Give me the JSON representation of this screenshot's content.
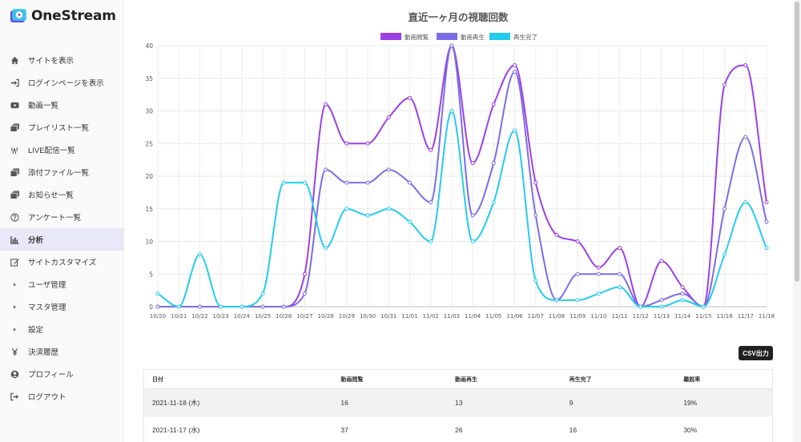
{
  "brand": {
    "name": "OneStream"
  },
  "sidebar": {
    "items": [
      {
        "label": "サイトを表示",
        "icon": "home-icon"
      },
      {
        "label": "ログインページを表示",
        "icon": "sign-in-icon"
      },
      {
        "label": "動画一覧",
        "icon": "video-icon"
      },
      {
        "label": "プレイリスト一覧",
        "icon": "playlist-icon"
      },
      {
        "label": "LIVE配信一覧",
        "icon": "broadcast-icon"
      },
      {
        "label": "添付ファイル一覧",
        "icon": "attachment-icon"
      },
      {
        "label": "お知らせ一覧",
        "icon": "news-icon"
      },
      {
        "label": "アンケート一覧",
        "icon": "question-icon"
      },
      {
        "label": "分析",
        "icon": "bar-chart-icon",
        "active": true
      },
      {
        "label": "サイトカスタマイズ",
        "icon": "edit-icon"
      },
      {
        "label": "ユーザ管理",
        "icon": "chevron-right-icon"
      },
      {
        "label": "マスタ管理",
        "icon": "chevron-right-icon"
      },
      {
        "label": "設定",
        "icon": "chevron-right-icon"
      },
      {
        "label": "決済履歴",
        "icon": "yen-icon"
      },
      {
        "label": "プロフィール",
        "icon": "user-icon"
      },
      {
        "label": "ログアウト",
        "icon": "sign-out-icon"
      }
    ]
  },
  "chart_data": {
    "type": "line",
    "title": "直近一ヶ月の視聴回数",
    "categories": [
      "10/20",
      "10/21",
      "10/22",
      "10/23",
      "10/24",
      "10/25",
      "10/26",
      "10/27",
      "10/28",
      "10/29",
      "10/30",
      "10/31",
      "11/01",
      "11/02",
      "11/03",
      "11/04",
      "11/05",
      "11/06",
      "11/07",
      "11/08",
      "11/09",
      "11/10",
      "11/11",
      "11/12",
      "11/13",
      "11/14",
      "11/15",
      "11/16",
      "11/17",
      "11/18"
    ],
    "series": [
      {
        "name": "動画閲覧",
        "color": "#9b3fe6",
        "values": [
          0,
          0,
          0,
          0,
          0,
          0,
          0,
          5,
          31,
          25,
          25,
          29,
          32,
          24,
          40,
          22,
          31,
          37,
          19,
          11,
          10,
          6,
          9,
          0,
          7,
          3,
          0,
          34,
          37,
          16
        ]
      },
      {
        "name": "動画再生",
        "color": "#7b6ce8",
        "values": [
          0,
          0,
          0,
          0,
          0,
          0,
          0,
          2,
          21,
          19,
          19,
          21,
          19,
          16,
          40,
          14,
          22,
          36,
          14,
          1,
          5,
          5,
          5,
          0,
          1,
          2,
          0,
          15,
          26,
          13
        ]
      },
      {
        "name": "再生完了",
        "color": "#22ccec",
        "values": [
          2,
          0,
          8,
          0,
          0,
          2,
          19,
          19,
          9,
          15,
          14,
          15,
          13,
          10,
          30,
          10,
          16,
          27,
          4,
          1,
          1,
          2,
          3,
          0,
          0,
          1,
          0,
          8,
          16,
          9
        ]
      }
    ],
    "ylim": [
      0,
      40
    ],
    "yticks": [
      0,
      5,
      10,
      15,
      20,
      25,
      30,
      35,
      40
    ],
    "grid": true,
    "legend": "top"
  },
  "toolbar": {
    "csv_label": "CSV出力"
  },
  "table": {
    "headers": [
      "日付",
      "動画閲覧",
      "動画再生",
      "再生完了",
      "離脱率"
    ],
    "rows": [
      [
        "2021-11-18 (木)",
        "16",
        "13",
        "9",
        "19%"
      ],
      [
        "2021-11-17 (水)",
        "37",
        "26",
        "16",
        "30%"
      ]
    ]
  }
}
